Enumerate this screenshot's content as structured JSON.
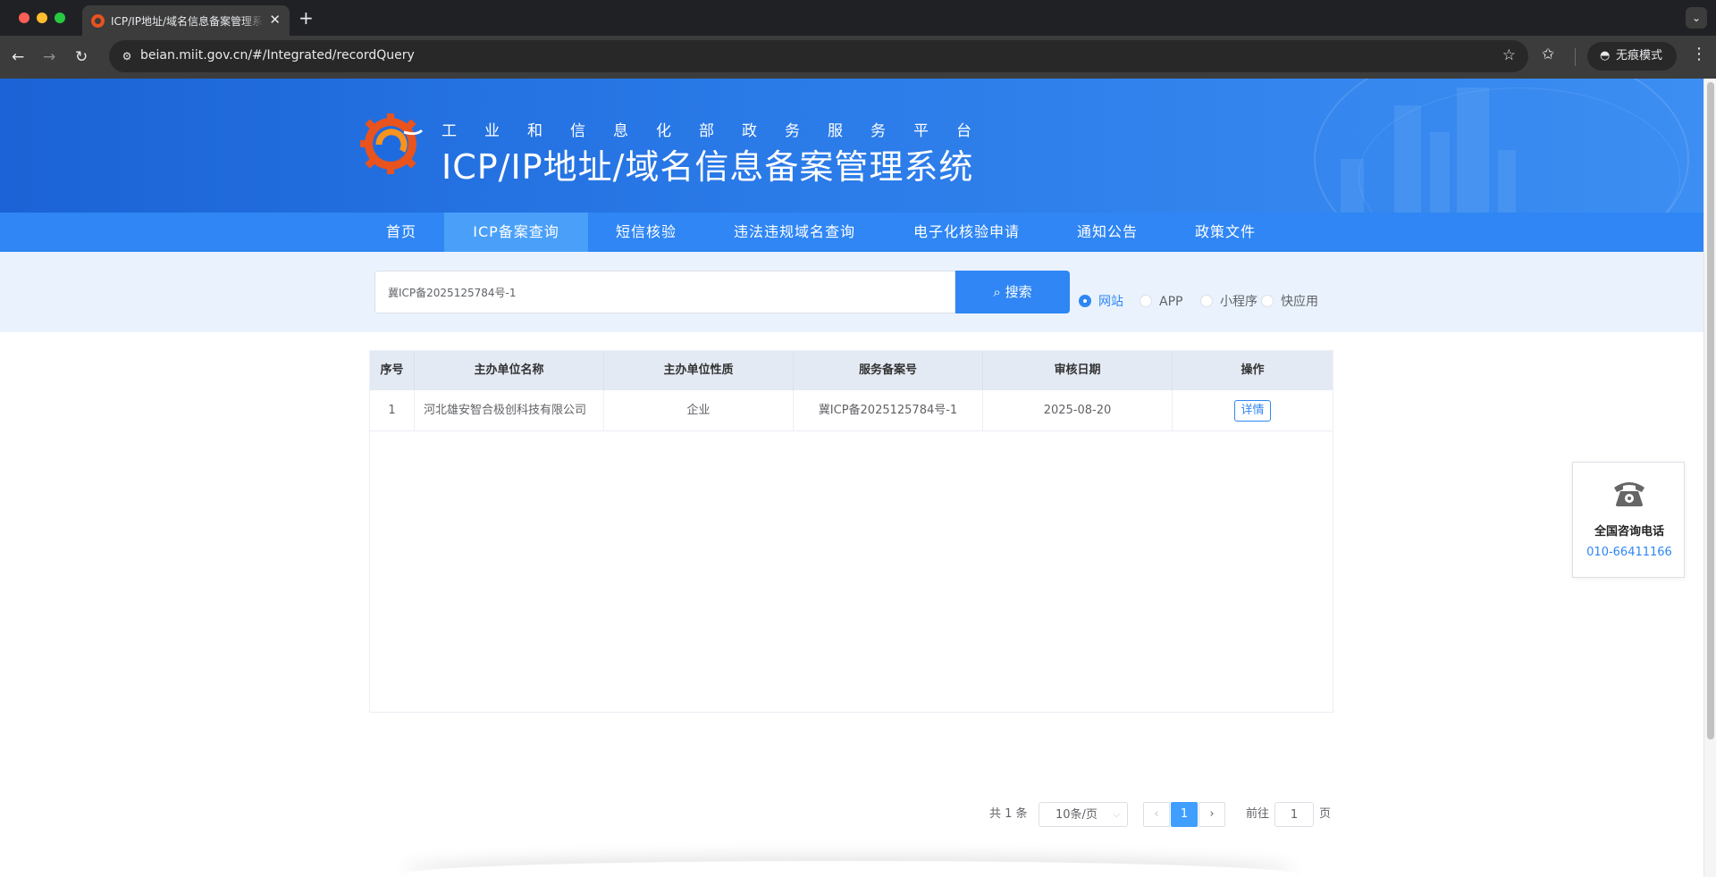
{
  "browser": {
    "tab_title": "ICP/IP地址/域名信息备案管理系统",
    "tab_close": "✕",
    "new_tab": "+",
    "url": "beian.miit.gov.cn/#/Integrated/recordQuery",
    "incognito_label": "无痕模式",
    "icons": [
      "back-icon",
      "forward-icon",
      "reload-icon",
      "site-info-icon",
      "bookmark-star-icon",
      "reading-list-icon",
      "incognito-icon",
      "more-menu-icon"
    ]
  },
  "header": {
    "subtitle": "工业和信息化部政务服务平台",
    "title": "ICP/IP地址/域名信息备案管理系统"
  },
  "nav": {
    "items": [
      {
        "label": "首页"
      },
      {
        "label": "ICP备案查询"
      },
      {
        "label": "短信核验"
      },
      {
        "label": "违法违规域名查询"
      },
      {
        "label": "电子化核验申请"
      },
      {
        "label": "通知公告"
      },
      {
        "label": "政策文件"
      }
    ],
    "active_index": 1
  },
  "search": {
    "value": "冀ICP备2025125784号-1",
    "button_label": "搜索",
    "types": [
      {
        "label": "网站",
        "selected": true
      },
      {
        "label": "APP",
        "selected": false
      },
      {
        "label": "小程序",
        "selected": false
      },
      {
        "label": "快应用",
        "selected": false
      }
    ]
  },
  "table": {
    "columns": [
      "序号",
      "主办单位名称",
      "主办单位性质",
      "服务备案号",
      "审核日期",
      "操作"
    ],
    "rows": [
      {
        "index": "1",
        "org_name": "河北雄安智合极创科技有限公司",
        "org_type": "企业",
        "record_no": "冀ICP备2025125784号-1",
        "date": "2025-08-20",
        "action": "详情"
      }
    ]
  },
  "pagination": {
    "total_text": "共 1 条",
    "page_size": "10条/页",
    "current_page": "1",
    "goto_label": "前往",
    "goto_value": "1",
    "page_unit": "页"
  },
  "hotline": {
    "title": "全国咨询电话",
    "number": "010-66411166"
  },
  "colors": {
    "primary": "#2f86f4",
    "banner": "#1b63d6",
    "nav_active": "#4aa0f8"
  }
}
